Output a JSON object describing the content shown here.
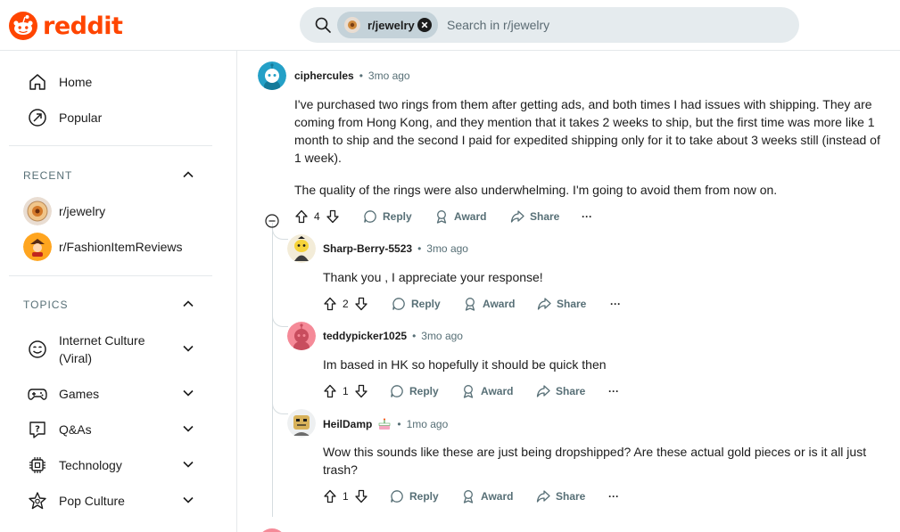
{
  "header": {
    "logo_text": "reddit",
    "search_chip": "r/jewelry",
    "search_placeholder": "Search in r/jewelry"
  },
  "sidebar": {
    "nav": [
      {
        "label": "Home",
        "icon": "home-icon"
      },
      {
        "label": "Popular",
        "icon": "popular-icon"
      }
    ],
    "recent": {
      "heading": "RECENT",
      "items": [
        {
          "label": "r/jewelry",
          "icon": "jewelry-community-icon"
        },
        {
          "label": "r/FashionItemReviews",
          "icon": "fashion-community-icon"
        }
      ]
    },
    "topics": {
      "heading": "TOPICS",
      "items": [
        {
          "label_line1": "Internet Culture",
          "label_line2": "(Viral)",
          "icon": "internet-culture-icon"
        },
        {
          "label": "Games",
          "icon": "gamepad-icon"
        },
        {
          "label": "Q&As",
          "icon": "qa-icon"
        },
        {
          "label": "Technology",
          "icon": "chip-icon"
        },
        {
          "label": "Pop Culture",
          "icon": "star-icon"
        }
      ]
    }
  },
  "comments": [
    {
      "author": "ciphercules",
      "time": "3mo ago",
      "paragraphs": [
        "I've purchased two rings from them after getting ads, and both times I had issues with shipping. They are coming from Hong Kong, and they mention that it takes 2 weeks to ship, but the first time was more like 1 month to ship and the second I paid for expedited shipping only for it to take about 3 weeks still (instead of 1 week).",
        "The quality of the rings were also underwhelming. I'm going to avoid them from now on."
      ],
      "votes": "4"
    },
    {
      "author": "Sharp-Berry-5523",
      "time": "3mo ago",
      "body": "Thank you , I appreciate your response!",
      "votes": "2"
    },
    {
      "author": "teddypicker1025",
      "time": "3mo ago",
      "body": "Im based in HK so hopefully it should be quick then",
      "votes": "1"
    },
    {
      "author": "HeilDamp",
      "time": "1mo ago",
      "body": "Wow this sounds like these are just being dropshipped? Are these actual gold pieces or is it all just trash?",
      "votes": "1"
    }
  ],
  "actions": {
    "reply": "Reply",
    "award": "Award",
    "share": "Share",
    "more": "···"
  },
  "colors": {
    "brand": "#ff4500",
    "meta": "#576f76",
    "search_bg": "#e5ebee",
    "chip_bg": "#c4d2d9"
  }
}
